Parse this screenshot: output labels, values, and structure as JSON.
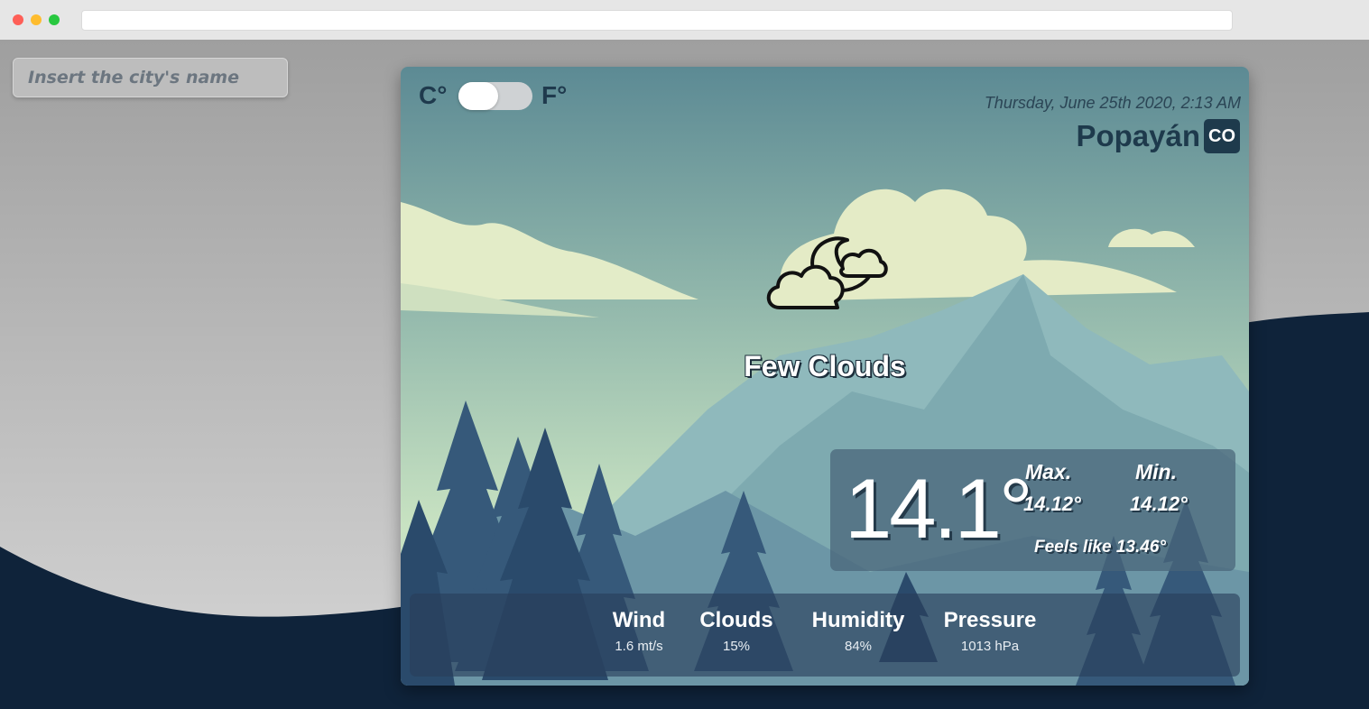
{
  "search": {
    "placeholder": "Insert the city's name",
    "value": ""
  },
  "units": {
    "celsius": "C°",
    "fahrenheit": "F°",
    "toggle_state": "celsius"
  },
  "header": {
    "date": "Thursday, June 25th 2020, 2:13 AM",
    "city": "Popayán",
    "country": "CO"
  },
  "weather": {
    "icon": "moon-clouds-icon",
    "description": "Few Clouds"
  },
  "temperature": {
    "current": "14.1°",
    "max_label": "Max.",
    "max_value": "14.12°",
    "min_label": "Min.",
    "min_value": "14.12°",
    "feels_like": "Feels like 13.46°"
  },
  "stats": {
    "wind_label": "Wind",
    "wind_value": "1.6 mt/s",
    "clouds_label": "Clouds",
    "clouds_value": "15%",
    "humidity_label": "Humidity",
    "humidity_value": "84%",
    "pressure_label": "Pressure",
    "pressure_value": "1013 hPa"
  },
  "colors": {
    "accent": "#1e3a4c",
    "page_dark": "#0f233a",
    "page_gray": "#a3a3a3"
  }
}
